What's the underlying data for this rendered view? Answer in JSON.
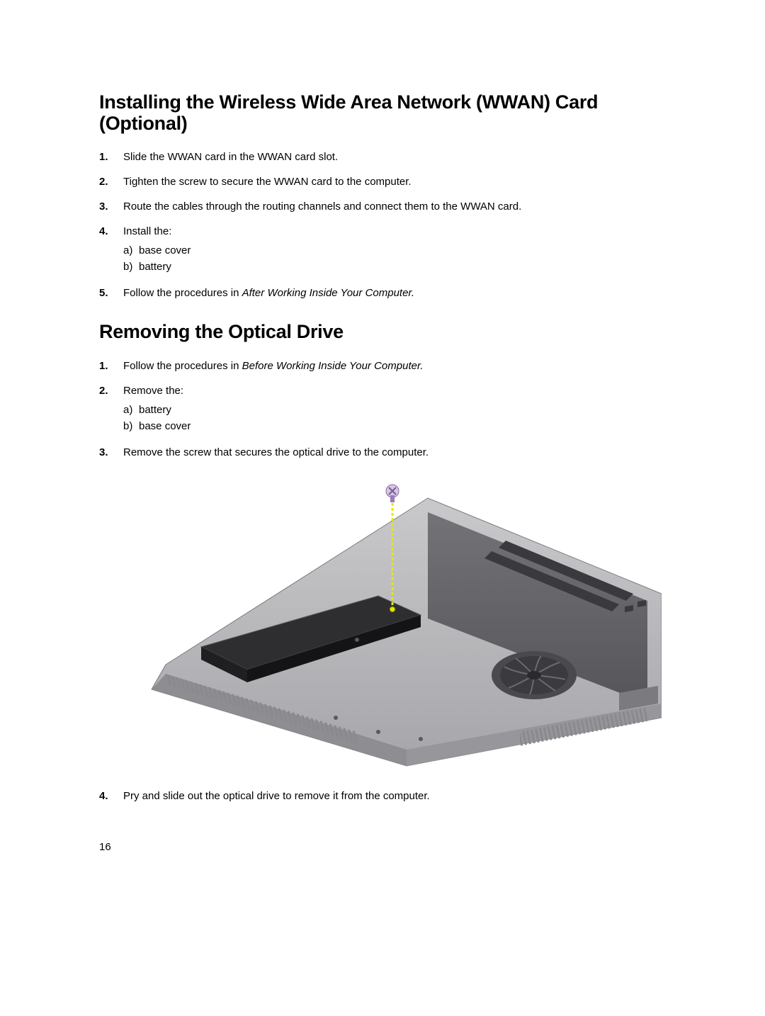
{
  "section1": {
    "heading": "Installing the Wireless Wide Area Network (WWAN) Card (Optional)",
    "items": [
      {
        "num": "1.",
        "text": "Slide the WWAN card in the WWAN card slot."
      },
      {
        "num": "2.",
        "text": "Tighten the screw to secure the WWAN card to the computer."
      },
      {
        "num": "3.",
        "text": "Route the cables through the routing channels and connect them to the WWAN card."
      },
      {
        "num": "4.",
        "text": "Install the:",
        "sub": [
          {
            "label": "a)",
            "text": "base cover"
          },
          {
            "label": "b)",
            "text": "battery"
          }
        ]
      },
      {
        "num": "5.",
        "text_pre": "Follow the procedures in ",
        "text_ital": "After Working Inside Your Computer.",
        "text_post": ""
      }
    ]
  },
  "section2": {
    "heading": "Removing the Optical Drive",
    "items_a": [
      {
        "num": "1.",
        "text_pre": "Follow the procedures in ",
        "text_ital": "Before Working Inside Your Computer.",
        "text_post": ""
      },
      {
        "num": "2.",
        "text": "Remove the:",
        "sub": [
          {
            "label": "a)",
            "text": "battery"
          },
          {
            "label": "b)",
            "text": "base cover"
          }
        ]
      },
      {
        "num": "3.",
        "text": "Remove the screw that secures the optical drive to the computer."
      }
    ],
    "items_b": [
      {
        "num": "4.",
        "text": "Pry and slide out the optical drive to remove it from the computer."
      }
    ]
  },
  "page_number": "16"
}
